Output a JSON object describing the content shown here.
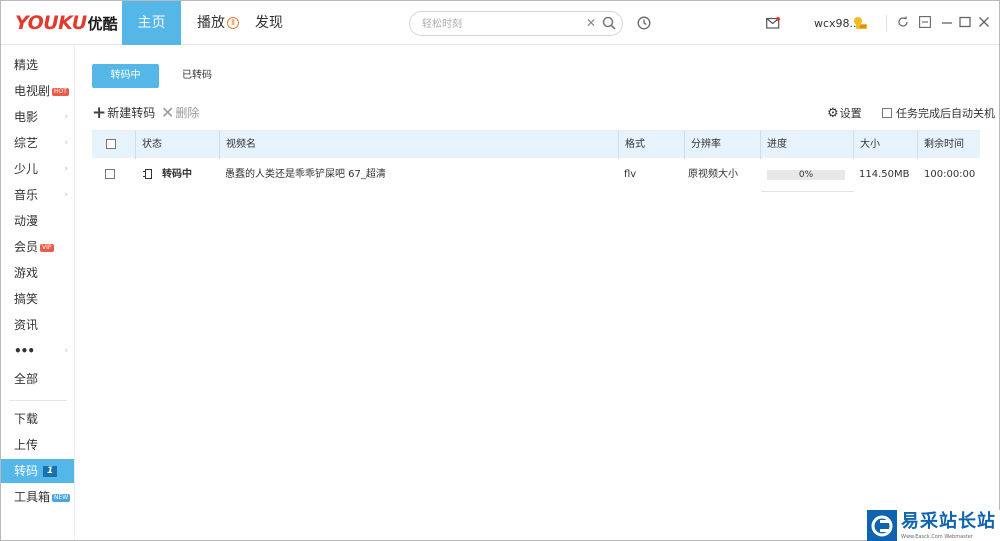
{
  "header": {
    "logo_en": "YOUKU",
    "logo_cn": "优酷",
    "nav": [
      {
        "label": "主页",
        "active": true
      },
      {
        "label": "播放",
        "badge": "Ⅱ"
      },
      {
        "label": "发现"
      }
    ],
    "search": {
      "placeholder": "轻松时刻"
    },
    "username": "wcx98...",
    "accent_color": "#55b7e8"
  },
  "sidebar": {
    "items": [
      {
        "label": "精选"
      },
      {
        "label": "电视剧",
        "tag": "HOT"
      },
      {
        "label": "电影",
        "arrow": "›"
      },
      {
        "label": "综艺",
        "arrow": "›"
      },
      {
        "label": "少儿",
        "arrow": "›"
      },
      {
        "label": "音乐",
        "arrow": "›"
      },
      {
        "label": "动漫"
      },
      {
        "label": "会员",
        "tag": "VIP"
      },
      {
        "label": "游戏"
      },
      {
        "label": "搞笑"
      },
      {
        "label": "资讯"
      },
      {
        "label": "•••",
        "arrow": "›"
      },
      {
        "label": "全部"
      }
    ],
    "bottom_items": [
      {
        "label": "下载"
      },
      {
        "label": "上传"
      },
      {
        "label": "转码",
        "count": "1",
        "active": true
      },
      {
        "label": "工具箱",
        "tag": "NEW"
      }
    ]
  },
  "main": {
    "tabs": [
      {
        "label": "转码中",
        "active": true
      },
      {
        "label": "已转码"
      }
    ],
    "toolbar": {
      "new_label": "新建转码",
      "delete_label": "删除",
      "settings_label": "设置",
      "auto_shutdown_label": "任务完成后自动关机"
    },
    "table": {
      "columns": [
        "状态",
        "视频名",
        "格式",
        "分辨率",
        "进度",
        "大小",
        "剩余时间"
      ],
      "rows": [
        {
          "status": "转码中",
          "name": "愚蠢的人类还是乖乖铲屎吧 67_超清",
          "format": "flv",
          "resolution": "原视频大小",
          "progress_text": "0%",
          "progress": 0,
          "size": "114.50MB",
          "remaining": "100:00:00"
        }
      ]
    }
  },
  "watermark": {
    "title": "易采站长站",
    "subtitle": "Www.Easck.Com Webmaster"
  }
}
